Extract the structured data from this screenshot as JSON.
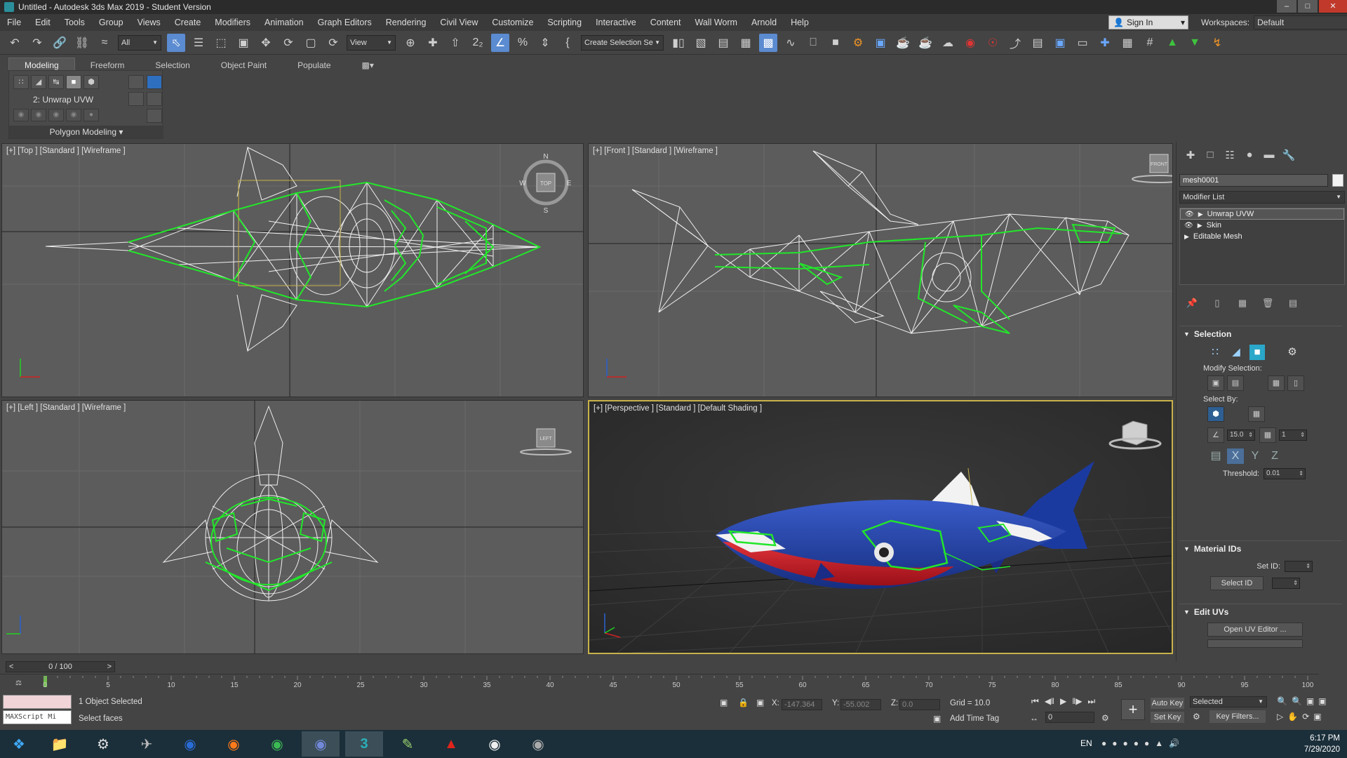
{
  "window": {
    "title": "Untitled - Autodesk 3ds Max 2019 - Student Version"
  },
  "menu": [
    "File",
    "Edit",
    "Tools",
    "Group",
    "Views",
    "Create",
    "Modifiers",
    "Animation",
    "Graph Editors",
    "Rendering",
    "Civil View",
    "Customize",
    "Scripting",
    "Interactive",
    "Content",
    "Wall Worm",
    "Arnold",
    "Help"
  ],
  "account": {
    "sign_in": "Sign In",
    "workspaces_label": "Workspaces:",
    "workspace": "Default"
  },
  "toolbar": {
    "filter": "All",
    "ref_coord": "View",
    "selection_set": "Create Selection Se"
  },
  "ribbon": {
    "tabs": [
      "Modeling",
      "Freeform",
      "Selection",
      "Object Paint",
      "Populate"
    ],
    "active_tab": "Modeling",
    "stack_label": "2: Unwrap UVW",
    "panel_label": "Polygon Modeling"
  },
  "viewports": {
    "top": {
      "label": "[+] [Top ] [Standard ] [Wireframe ]",
      "cube": "TOP",
      "compass": [
        "N",
        "S",
        "E",
        "W"
      ]
    },
    "front": {
      "label": "[+] [Front ] [Standard ] [Wireframe ]",
      "cube": "FRONT"
    },
    "left": {
      "label": "[+] [Left ] [Standard ] [Wireframe ]",
      "cube": "LEFT"
    },
    "persp": {
      "label": "[+] [Perspective ] [Standard ] [Default Shading ]"
    }
  },
  "command_panel": {
    "object_name": "mesh0001",
    "modifier_list": "Modifier List",
    "stack": [
      "Unwrap UVW",
      "Skin",
      "Editable Mesh"
    ],
    "selection": {
      "title": "Selection",
      "modify_selection": "Modify Selection:",
      "select_by": "Select By:",
      "angle": "15.0",
      "count": "1",
      "threshold_label": "Threshold:",
      "threshold": "0.01"
    },
    "material_ids": {
      "title": "Material IDs",
      "set_id": "Set ID:",
      "select_id": "Select ID"
    },
    "edit_uvs": {
      "title": "Edit UVs",
      "open_editor": "Open UV Editor ..."
    }
  },
  "timeline": {
    "frame_display": "0 / 100",
    "ticks": [
      "0",
      "5",
      "10",
      "15",
      "20",
      "25",
      "30",
      "35",
      "40",
      "45",
      "50",
      "55",
      "60",
      "65",
      "70",
      "75",
      "80",
      "85",
      "90",
      "95",
      "100"
    ]
  },
  "status": {
    "objects": "1 Object Selected",
    "prompt": "Select faces",
    "maxscript": "MAXScript Mi",
    "x_label": "X:",
    "x": "-147.364",
    "y_label": "Y:",
    "y": "-55.002",
    "z_label": "Z:",
    "z": "0.0",
    "grid": "Grid = 10.0",
    "add_time_tag": "Add Time Tag",
    "auto_key": "Auto Key",
    "set_key": "Set Key",
    "key_mode": "Selected",
    "key_filters": "Key Filters...",
    "current_frame": "0"
  },
  "taskbar": {
    "apps": [
      "windows-start",
      "file-explorer",
      "steam",
      "tool-app",
      "app-blue",
      "firefox",
      "chrome",
      "discord",
      "3ds-max",
      "notes",
      "acrobat",
      "dark-app",
      "gimp"
    ],
    "lang": "EN",
    "time": "6:17 PM",
    "date": "7/29/2020"
  },
  "colors": {
    "wire": "#ffffff",
    "selected_wire": "#22e62a",
    "shark_blue": "#1e3fa5",
    "shark_red": "#c81f28",
    "fin_white": "#f2f2f2",
    "viewport_bg": "#5c5c5c",
    "persp_bg": "#2f2f2f",
    "active_border": "#c8b24a"
  }
}
